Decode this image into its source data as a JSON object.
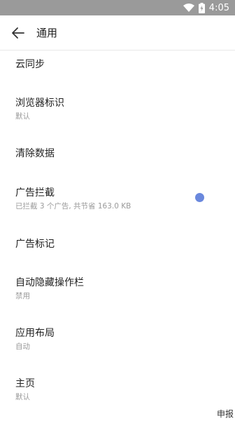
{
  "status_bar": {
    "time": "4:05",
    "icons": [
      "wifi-icon",
      "battery-charging-icon"
    ],
    "color": "#9a9a9a"
  },
  "header": {
    "back_icon": "arrow-left-icon",
    "title": "通用"
  },
  "settings": [
    {
      "title": "云同步"
    },
    {
      "title": "浏览器标识",
      "subtitle": "默认"
    },
    {
      "title": "清除数据"
    },
    {
      "title": "广告拦截",
      "subtitle": "已拦截 3 个广告, 共节省 163.0 KB",
      "toggle": "on"
    },
    {
      "title": "广告标记"
    },
    {
      "title": "自动隐藏操作栏",
      "subtitle": "禁用"
    },
    {
      "title": "应用布局",
      "subtitle": "自动"
    },
    {
      "title": "主页",
      "subtitle": "默认"
    }
  ],
  "accent_color": "#6a88dd",
  "corner_text": "申报"
}
